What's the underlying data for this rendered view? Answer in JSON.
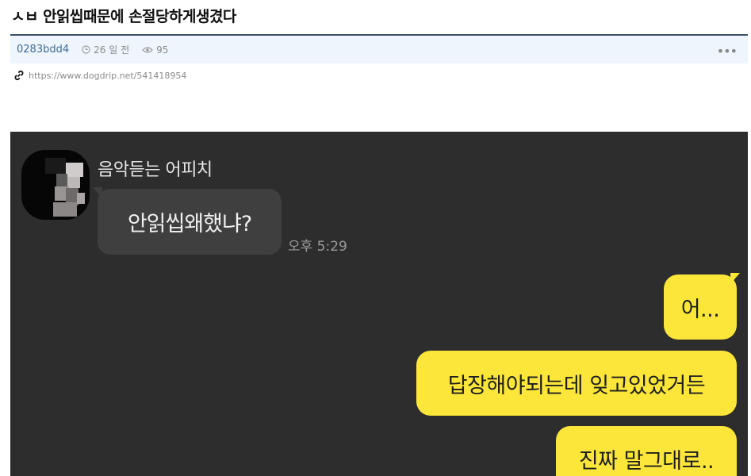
{
  "post": {
    "title": "ㅅㅂ 안읽씹때문에 손절당하게생겼다",
    "author": "0283bdd4",
    "time_ago": "26 일 전",
    "views": "95",
    "more": "•••",
    "link": "https://www.dogdrip.net/541418954"
  },
  "chat": {
    "sender_name": "음악듣는 어피치",
    "received": {
      "text": "안읽씹왜했냐?",
      "time": "오후 5:29"
    },
    "sent": [
      {
        "text": "어..."
      },
      {
        "text": "답장해야되는데 잊고있었거든"
      },
      {
        "text": "진짜 말그대로.."
      }
    ]
  },
  "colors": {
    "chat_background": "#2d2d2d",
    "sent_bubble": "#fce63a",
    "received_bubble": "#3f3f3f",
    "title_rule": "#3d4f63",
    "meta_background": "#eef5fc",
    "author_link": "#3f6b95"
  },
  "icons": {
    "time": "clock-icon",
    "views": "eye-icon",
    "link": "link-icon",
    "more": "more-dots-icon"
  }
}
